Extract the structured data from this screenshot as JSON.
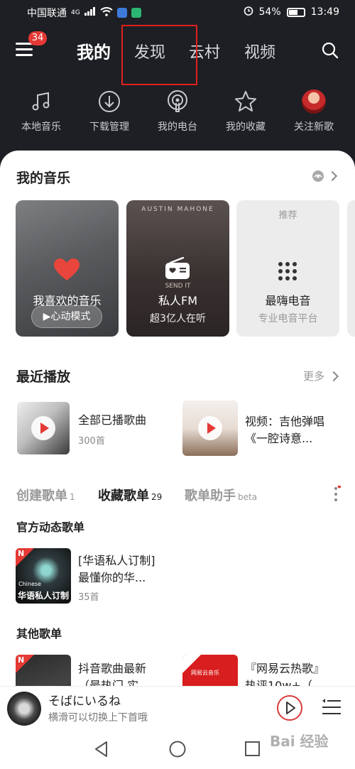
{
  "status": {
    "carrier": "中国联通",
    "signal": "4G",
    "battery": "54%",
    "time": "13:49"
  },
  "header": {
    "badge": "34",
    "tabs": [
      "我的",
      "发现",
      "云村",
      "视频"
    ]
  },
  "quick": [
    {
      "label": "本地音乐",
      "icon": "music-note-icon"
    },
    {
      "label": "下载管理",
      "icon": "download-icon"
    },
    {
      "label": "我的电台",
      "icon": "podcast-icon"
    },
    {
      "label": "我的收藏",
      "icon": "star-icon"
    },
    {
      "label": "关注新歌",
      "icon": "avatar"
    }
  ],
  "my_music": {
    "title": "我的音乐",
    "cards": [
      {
        "title": "我喜欢的音乐",
        "button": "▶心动模式"
      },
      {
        "title": "私人FM",
        "sub": "超3亿人在听",
        "art_text": "AUSTIN MAHONE",
        "art_sub": "SEND IT"
      },
      {
        "tag": "推荐",
        "title": "最嗨电音",
        "sub": "专业电音平台"
      }
    ]
  },
  "recent": {
    "title": "最近播放",
    "more": "更多",
    "items": [
      {
        "title": "全部已播歌曲",
        "sub": "300首"
      },
      {
        "title_line1": "视频：吉他弹唱",
        "title_line2": "《一腔诗意..."
      }
    ]
  },
  "playlist_tabs": [
    {
      "label": "创建歌单",
      "count": "1"
    },
    {
      "label": "收藏歌单",
      "count": "29"
    },
    {
      "label": "歌单助手",
      "count": "beta"
    }
  ],
  "official": {
    "title": "官方动态歌单",
    "item": {
      "line1": "[华语私人订制]",
      "line2": "最懂你的华...",
      "sub": "35首",
      "cover_small": "Chinese",
      "cover_big": "华语私人订制"
    }
  },
  "others": {
    "title": "其他歌单",
    "items": [
      {
        "line1": "抖音歌曲最新",
        "line2": "（最热门 实"
      },
      {
        "line1": "『网易云热歌』",
        "line2": "热评10w+（",
        "brand": "网易云音乐"
      }
    ]
  },
  "player": {
    "title": "そばにいるね",
    "sub": "横滑可以切换上下首哦"
  },
  "watermark": "Bai 经验"
}
